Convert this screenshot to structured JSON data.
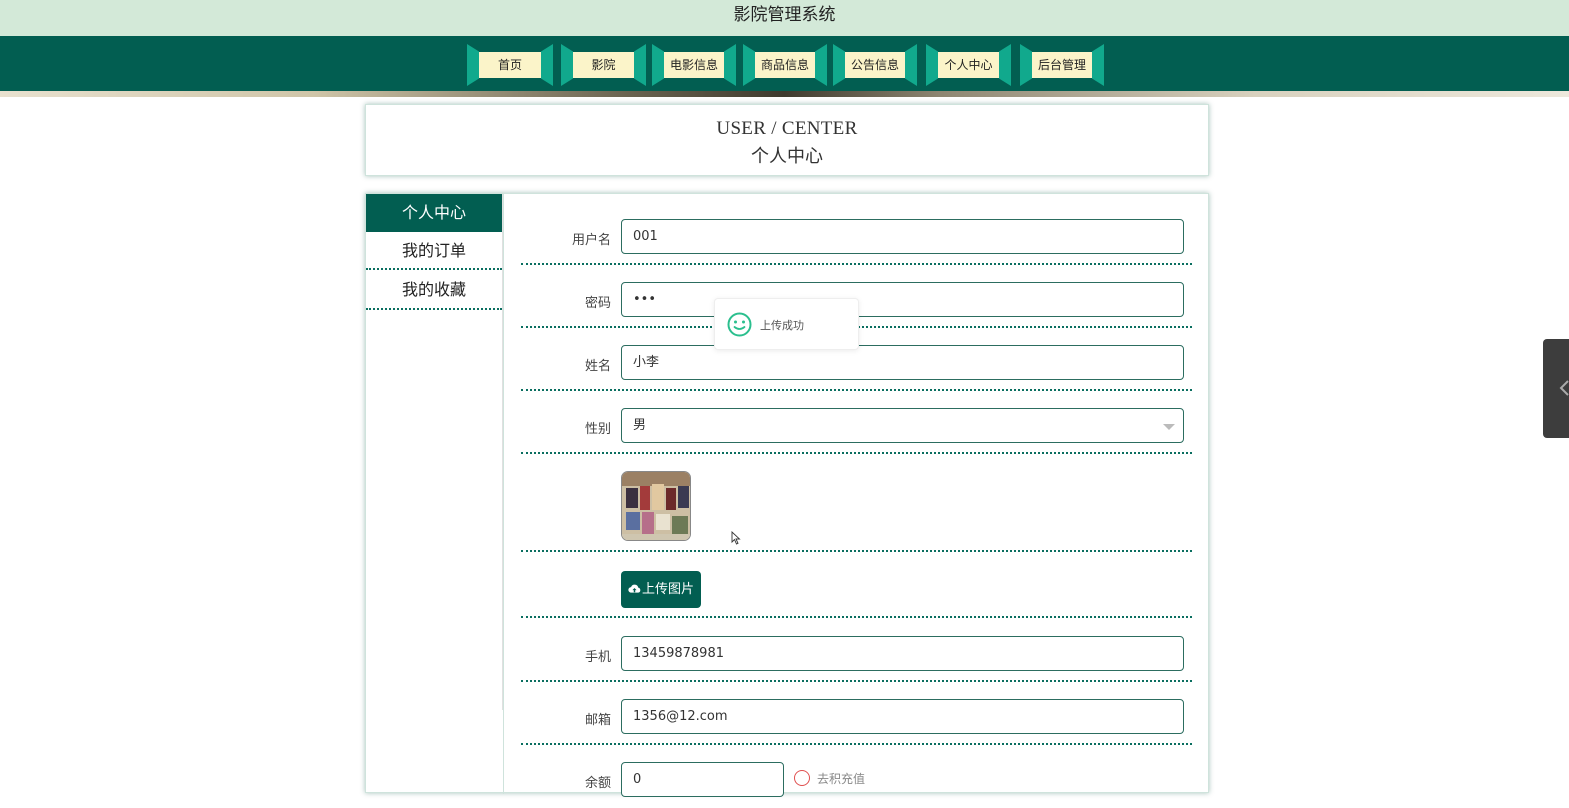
{
  "app": {
    "title": "影院管理系统"
  },
  "nav": {
    "items": [
      {
        "label": "首页"
      },
      {
        "label": "影院"
      },
      {
        "label": "电影信息"
      },
      {
        "label": "商品信息"
      },
      {
        "label": "公告信息"
      },
      {
        "label": "个人中心"
      },
      {
        "label": "后台管理"
      }
    ]
  },
  "header": {
    "title_en": "USER / CENTER",
    "title_cn": "个人中心"
  },
  "sidebar": {
    "items": [
      {
        "label": "个人中心",
        "active": true
      },
      {
        "label": "我的订单"
      },
      {
        "label": "我的收藏"
      }
    ]
  },
  "form": {
    "username": {
      "label": "用户名",
      "value": "001"
    },
    "password": {
      "label": "密码",
      "value": "•••"
    },
    "name": {
      "label": "姓名",
      "value": "小李"
    },
    "gender": {
      "label": "性别",
      "value": "男"
    },
    "upload_button": "上传图片",
    "phone": {
      "label": "手机",
      "value": "13459878981"
    },
    "email": {
      "label": "邮箱",
      "value": "1356@12.com"
    },
    "balance": {
      "label": "余额",
      "value": "0",
      "note": "去积充值"
    }
  },
  "toast": {
    "message": "上传成功"
  },
  "colors": {
    "primary": "#025e51",
    "accent": "#11a98d",
    "nav_label_bg": "#fbf4c9",
    "topbar_bg": "#d3e9d8"
  }
}
